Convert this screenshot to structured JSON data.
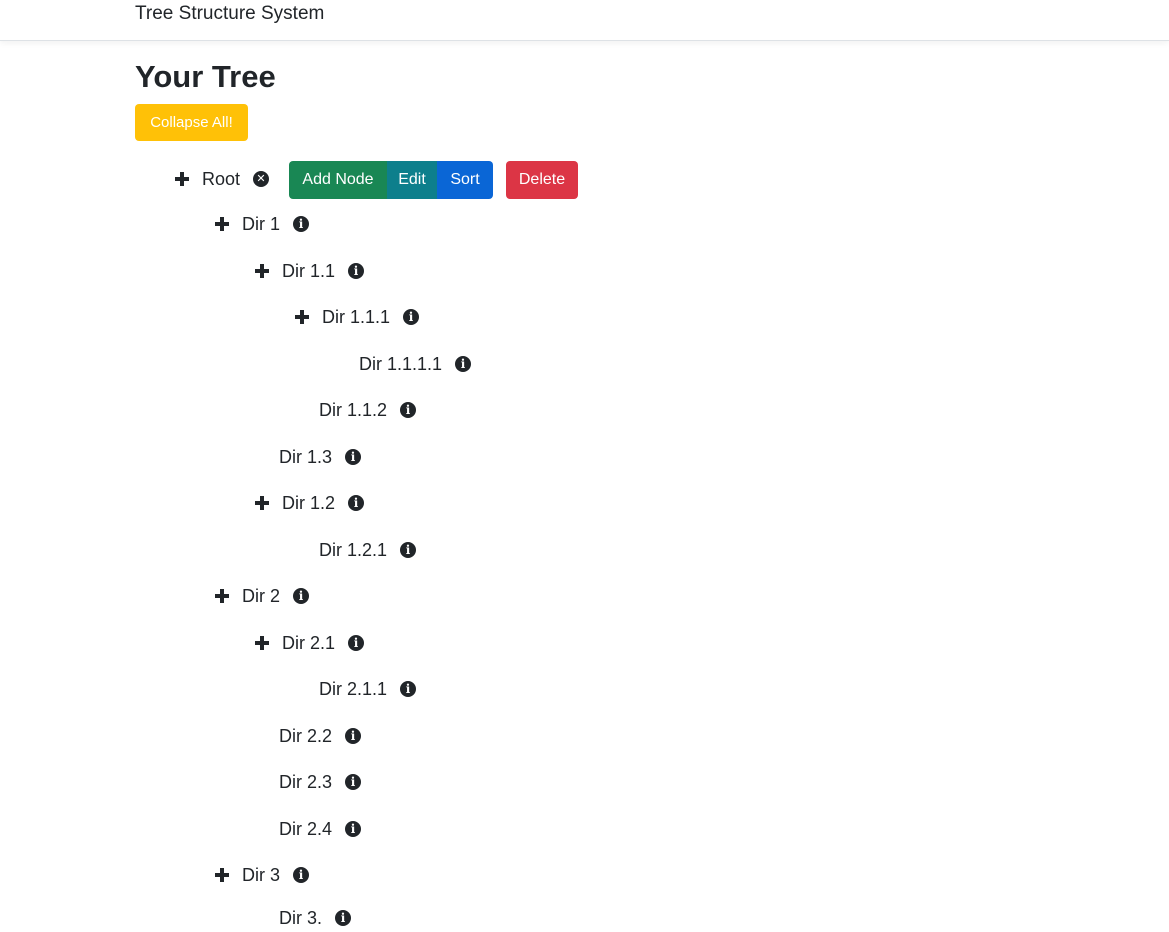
{
  "navbar": {
    "brand": "Tree Structure System"
  },
  "page": {
    "title": "Your Tree"
  },
  "toolbar": {
    "collapse_label": "Collapse All!"
  },
  "root": {
    "label": "Root",
    "actions": {
      "add": "Add Node",
      "edit": "Edit",
      "sort": "Sort",
      "delete": "Delete"
    }
  },
  "tree": {
    "nodes": [
      {
        "label": "Dir 1",
        "expandable": true
      },
      {
        "label": "Dir 1.1",
        "expandable": true
      },
      {
        "label": "Dir 1.1.1",
        "expandable": true
      },
      {
        "label": "Dir 1.1.1.1",
        "expandable": false
      },
      {
        "label": "Dir 1.1.2",
        "expandable": false
      },
      {
        "label": "Dir 1.3",
        "expandable": false
      },
      {
        "label": "Dir 1.2",
        "expandable": true
      },
      {
        "label": "Dir 1.2.1",
        "expandable": false
      },
      {
        "label": "Dir 2",
        "expandable": true
      },
      {
        "label": "Dir 2.1",
        "expandable": true
      },
      {
        "label": "Dir 2.1.1",
        "expandable": false
      },
      {
        "label": "Dir 2.2",
        "expandable": false
      },
      {
        "label": "Dir 2.3",
        "expandable": false
      },
      {
        "label": "Dir 2.4",
        "expandable": false
      },
      {
        "label": "Dir 3",
        "expandable": true
      },
      {
        "label": "Dir 3.",
        "expandable": false
      }
    ]
  },
  "icons": {
    "expand": "plus-icon",
    "info": "info-circle-icon",
    "remove": "times-circle-icon"
  },
  "colors": {
    "collapse": "#ffc107",
    "add": "#198754",
    "edit": "#0d7f8c",
    "sort": "#0a66d6",
    "delete": "#dc3545"
  }
}
